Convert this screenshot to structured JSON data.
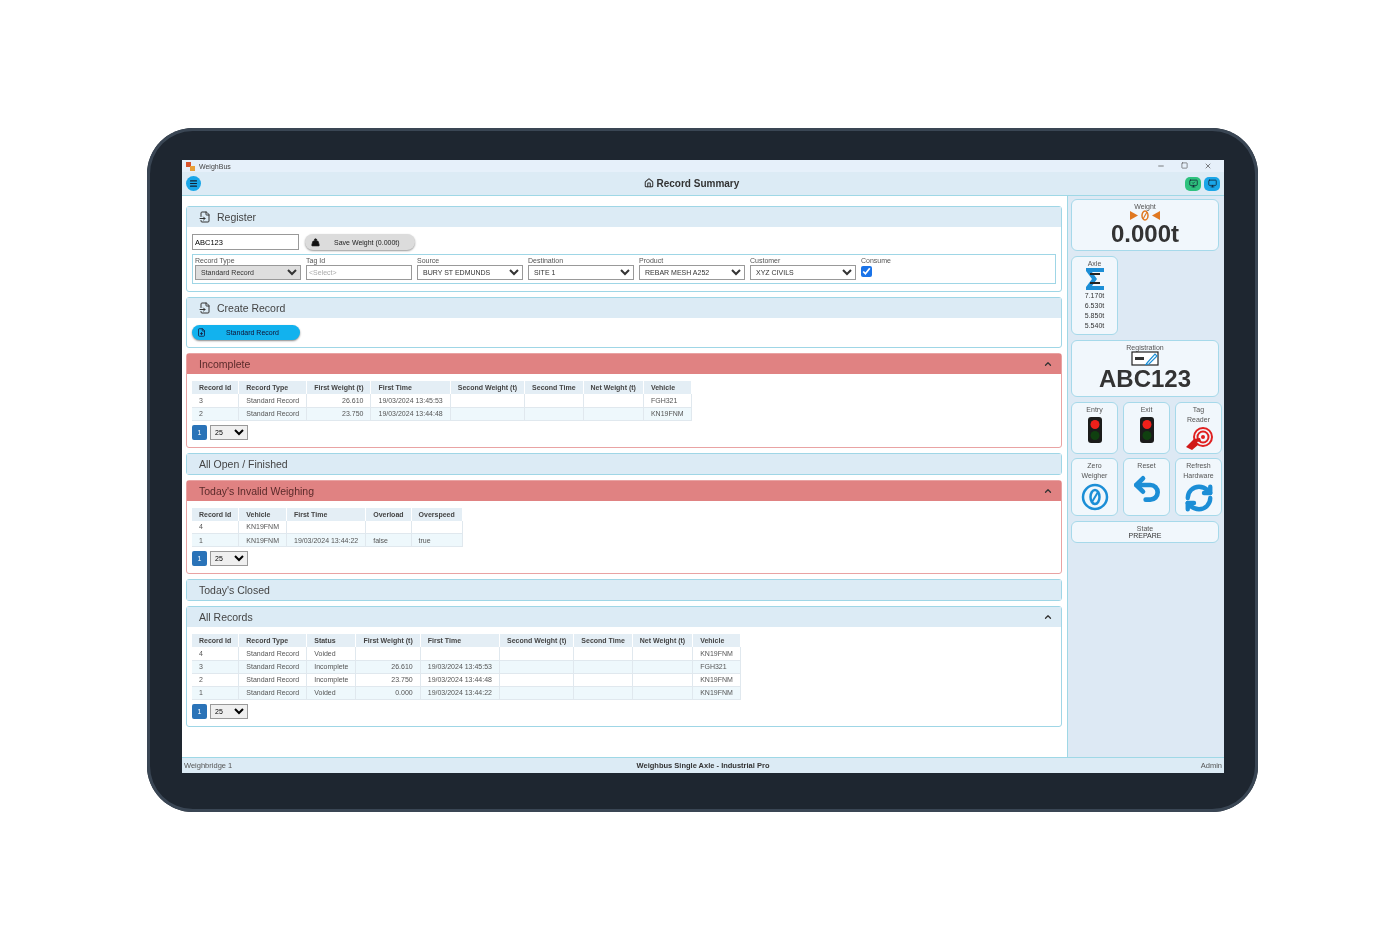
{
  "window": {
    "title": "WeighBus"
  },
  "header": {
    "title": "Record Summary"
  },
  "register": {
    "title": "Register",
    "registration": "ABC123",
    "save_button": "Save Weight (0.000t)",
    "fields": [
      {
        "kind": "select",
        "label": "Record Type",
        "value": "Standard Record",
        "disabled": true
      },
      {
        "kind": "input",
        "label": "Tag Id",
        "placeholder": "<Select>"
      },
      {
        "kind": "select",
        "label": "Source",
        "value": "BURY ST EDMUNDS",
        "disabled": false
      },
      {
        "kind": "select",
        "label": "Destination",
        "value": "SITE 1",
        "disabled": false
      },
      {
        "kind": "select",
        "label": "Product",
        "value": "REBAR MESH A252",
        "disabled": false
      },
      {
        "kind": "select",
        "label": "Customer",
        "value": "XYZ CIVILS",
        "disabled": false
      },
      {
        "kind": "checkbox",
        "label": "Consume",
        "checked": true
      }
    ]
  },
  "create_record": {
    "title": "Create Record",
    "buttons": [
      "Standard Record"
    ]
  },
  "sections": [
    {
      "title": "Incomplete",
      "alert": true,
      "expanded": true,
      "table": {
        "columns": [
          {
            "label": "Record Id"
          },
          {
            "label": "Record Type"
          },
          {
            "label": "First Weight (t)",
            "numeric": true
          },
          {
            "label": "First Time"
          },
          {
            "label": "Second Weight (t)",
            "numeric": true
          },
          {
            "label": "Second Time"
          },
          {
            "label": "Net Weight (t)",
            "numeric": true
          },
          {
            "label": "Vehicle"
          }
        ],
        "rows": [
          [
            "3",
            "Standard Record",
            "26.610",
            "19/03/2024 13:45:53",
            null,
            null,
            null,
            "FGH321"
          ],
          [
            "2",
            "Standard Record",
            "23.750",
            "19/03/2024 13:44:48",
            null,
            null,
            null,
            "KN19FNM"
          ]
        ]
      },
      "pager": {
        "page": "1",
        "page_size": "25"
      }
    },
    {
      "title": "All Open / Finished",
      "alert": false,
      "expanded": false
    },
    {
      "title": "Today's Invalid Weighing",
      "alert": true,
      "expanded": true,
      "table": {
        "columns": [
          {
            "label": "Record Id"
          },
          {
            "label": "Vehicle"
          },
          {
            "label": "First Time"
          },
          {
            "label": "Overload"
          },
          {
            "label": "Overspeed"
          }
        ],
        "rows": [
          [
            "4",
            "KN19FNM",
            null,
            null,
            null
          ],
          [
            "1",
            "KN19FNM",
            "19/03/2024 13:44:22",
            "false",
            "true"
          ]
        ]
      },
      "pager": {
        "page": "1",
        "page_size": "25"
      }
    },
    {
      "title": "Today's Closed",
      "alert": false,
      "expanded": false
    },
    {
      "title": "All Records",
      "alert": false,
      "expanded": true,
      "table": {
        "columns": [
          {
            "label": "Record Id"
          },
          {
            "label": "Record Type"
          },
          {
            "label": "Status"
          },
          {
            "label": "First Weight (t)",
            "numeric": true
          },
          {
            "label": "First Time"
          },
          {
            "label": "Second Weight (t)",
            "numeric": true
          },
          {
            "label": "Second Time"
          },
          {
            "label": "Net Weight (t)",
            "numeric": true
          },
          {
            "label": "Vehicle"
          }
        ],
        "rows": [
          [
            "4",
            "Standard Record",
            "Voided",
            null,
            null,
            null,
            null,
            null,
            "KN19FNM"
          ],
          [
            "3",
            "Standard Record",
            "Incomplete",
            "26.610",
            "19/03/2024 13:45:53",
            null,
            null,
            null,
            "FGH321"
          ],
          [
            "2",
            "Standard Record",
            "Incomplete",
            "23.750",
            "19/03/2024 13:44:48",
            null,
            null,
            null,
            "KN19FNM"
          ],
          [
            "1",
            "Standard Record",
            "Voided",
            "0.000",
            "19/03/2024 13:44:22",
            null,
            null,
            null,
            "KN19FNM"
          ]
        ]
      },
      "pager": {
        "page": "1",
        "page_size": "25"
      }
    }
  ],
  "side": {
    "weight": {
      "label": "Weight",
      "value": "0.000t"
    },
    "axle": {
      "label": "Axle",
      "readings": [
        "7.170t",
        "6.530t",
        "5.850t",
        "5.540t"
      ]
    },
    "registration": {
      "label": "Registration",
      "value": "ABC123"
    },
    "buttons": [
      {
        "kind": "light",
        "label": "Entry",
        "red_on": true
      },
      {
        "kind": "light",
        "label": "Exit",
        "red_on": true
      },
      {
        "kind": "tag-reader",
        "label": "Tag Reader"
      },
      {
        "kind": "zero",
        "label": "Zero Weigher"
      },
      {
        "kind": "reset",
        "label": "Reset"
      },
      {
        "kind": "refresh",
        "label": "Refresh Hardware"
      }
    ],
    "state": {
      "label": "State",
      "value": "PREPARE"
    }
  },
  "status_bar": {
    "left": "Weighbridge 1",
    "center": "Weighbus Single Axle - Industrial Pro",
    "right": "Admin"
  }
}
